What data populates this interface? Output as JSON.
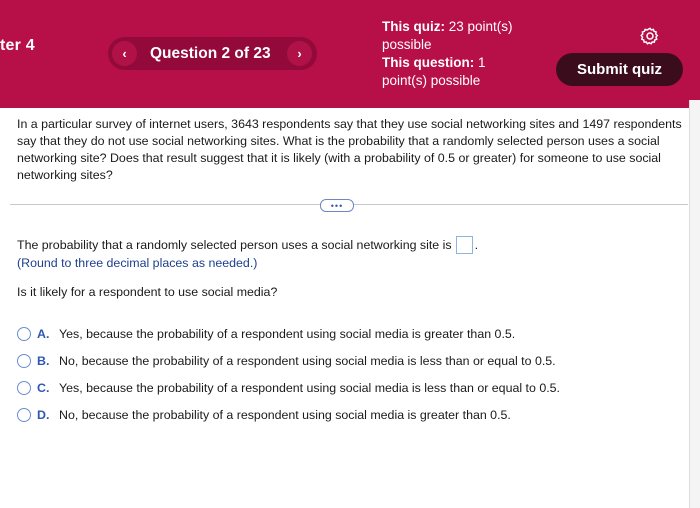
{
  "header": {
    "chapter": "ter 4",
    "question_label": "Question 2 of 23",
    "prev_icon": "‹",
    "next_icon": "›",
    "quiz_points_label": "This quiz:",
    "quiz_points_value": "23 point(s) possible",
    "question_points_label": "This question:",
    "question_points_value": "1 point(s) possible",
    "submit_label": "Submit quiz",
    "settings_icon": "gear-icon"
  },
  "problem": {
    "text": "In a particular survey of internet users, 3643 respondents say that they use social networking sites and 1497 respondents say that they do not use social networking sites. What is the probability that a randomly selected person uses a social networking site? Does that result suggest that it is likely (with a probability of 0.5 or greater) for someone to use social networking sites?",
    "more_label": "•••"
  },
  "answer": {
    "prompt": "The probability that a randomly selected person uses a social networking site is",
    "suffix": ".",
    "value": "",
    "hint": "(Round to three decimal places as needed.)"
  },
  "question2": {
    "prompt": "Is it likely for a respondent to use social media?",
    "options": [
      {
        "letter": "A.",
        "text": "Yes, because the probability of a respondent using social media is greater than 0.5."
      },
      {
        "letter": "B.",
        "text": "No, because the probability of a respondent using social media is less than or equal to 0.5."
      },
      {
        "letter": "C.",
        "text": "Yes, because the probability of a respondent using social media is less than or equal to 0.5."
      },
      {
        "letter": "D.",
        "text": "No, because the probability of a respondent using social media is greater than 0.5."
      }
    ]
  },
  "colors": {
    "header_bg": "#b70f47",
    "submit_bg": "#3b0d1c",
    "accent_blue": "#2d57b0"
  }
}
